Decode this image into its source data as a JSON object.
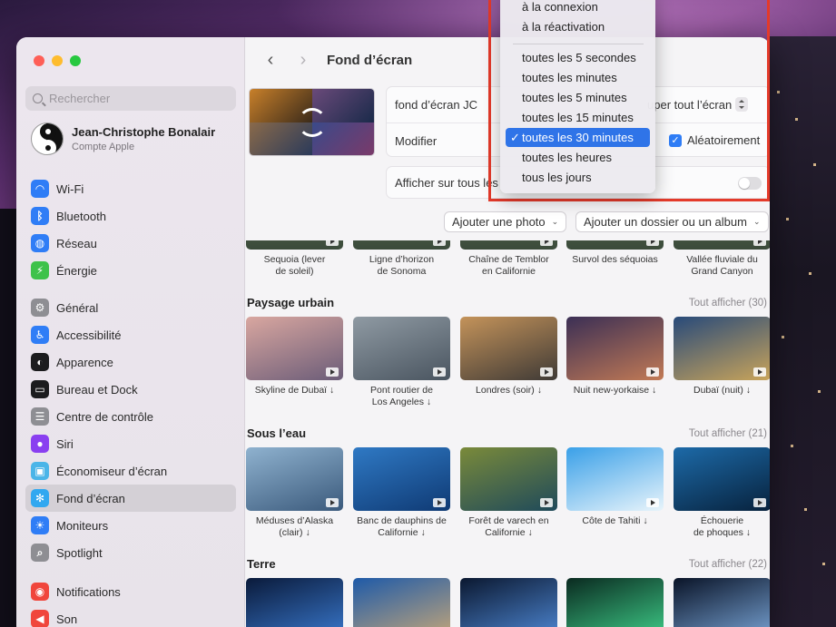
{
  "window": {
    "title": "Fond d’écran"
  },
  "search": {
    "placeholder": "Rechercher"
  },
  "account": {
    "name": "Jean-Christophe Bonalair",
    "subtitle": "Compte Apple"
  },
  "sidebar": {
    "groups": [
      [
        {
          "label": "Wi-Fi",
          "icon": "wifi-icon",
          "color": "#2f7df6"
        },
        {
          "label": "Bluetooth",
          "icon": "bluetooth-icon",
          "color": "#2f7df6"
        },
        {
          "label": "Réseau",
          "icon": "globe-icon",
          "color": "#2f7df6"
        },
        {
          "label": "Énergie",
          "icon": "battery-icon",
          "color": "#3ec24a"
        }
      ],
      [
        {
          "label": "Général",
          "icon": "gear-icon",
          "color": "#8e8e93"
        },
        {
          "label": "Accessibilité",
          "icon": "accessibility-icon",
          "color": "#2f7df6"
        },
        {
          "label": "Apparence",
          "icon": "appearance-icon",
          "color": "#1c1c1e"
        },
        {
          "label": "Bureau et Dock",
          "icon": "dock-icon",
          "color": "#1c1c1e"
        },
        {
          "label": "Centre de contrôle",
          "icon": "control-center-icon",
          "color": "#8e8e93"
        },
        {
          "label": "Siri",
          "icon": "siri-icon",
          "color": "#8a3ff0"
        },
        {
          "label": "Économiseur d’écran",
          "icon": "screensaver-icon",
          "color": "#4bb5e8"
        },
        {
          "label": "Fond d’écran",
          "icon": "wallpaper-icon",
          "color": "#31a8f0",
          "active": true
        },
        {
          "label": "Moniteurs",
          "icon": "sun-icon",
          "color": "#2f7df6"
        },
        {
          "label": "Spotlight",
          "icon": "spotlight-icon",
          "color": "#8e8e93"
        }
      ],
      [
        {
          "label": "Notifications",
          "icon": "bell-icon",
          "color": "#f0463c"
        },
        {
          "label": "Son",
          "icon": "speaker-icon",
          "color": "#f0463c"
        }
      ]
    ]
  },
  "settings": {
    "wallpaper_name": "fond d’écran JC",
    "fill_mode_visible": "uper tout l’écran",
    "modify_label": "Modifier",
    "random_label": "Aléatoirement",
    "show_all_spaces_visible": "Afficher sur tous les",
    "show_all_spaces_on": false
  },
  "buttons": {
    "add_photo": "Ajouter une photo",
    "add_folder": "Ajouter un dossier ou un album"
  },
  "menu": {
    "items": [
      "à la connexion",
      "à la réactivation",
      "toutes les 5 secondes",
      "toutes les minutes",
      "toutes les 5 minutes",
      "toutes les 15 minutes",
      "toutes les 30 minutes",
      "toutes les heures",
      "tous les jours"
    ],
    "selected_index": 6,
    "check_glyph": "✓"
  },
  "gallery": {
    "top_row": [
      {
        "caption": "Sequoia (lever\nde soleil)"
      },
      {
        "caption": "Ligne d’horizon\nde Sonoma"
      },
      {
        "caption": "Chaîne de Temblor\nen Californie"
      },
      {
        "caption": "Survol des séquoias"
      },
      {
        "caption": "Vallée fluviale du\nGrand Canyon"
      }
    ],
    "sections": [
      {
        "title": "Paysage urbain",
        "link": "Tout afficher (30)",
        "items": [
          {
            "caption": "Skyline de Dubaï ↓",
            "colors": [
              "#d9a7a0",
              "#6b5c78"
            ]
          },
          {
            "caption": "Pont routier de\nLos Angeles ↓",
            "colors": [
              "#8f9aa3",
              "#4a5560"
            ]
          },
          {
            "caption": "Londres (soir) ↓",
            "colors": [
              "#c4935a",
              "#3f3a36"
            ]
          },
          {
            "caption": "Nuit new-yorkaise ↓",
            "colors": [
              "#3b2f55",
              "#c27a55"
            ]
          },
          {
            "caption": "Dubaï (nuit) ↓",
            "colors": [
              "#284a7a",
              "#c9a45a"
            ]
          }
        ]
      },
      {
        "title": "Sous l’eau",
        "link": "Tout afficher (21)",
        "items": [
          {
            "caption": "Méduses d’Alaska\n(clair) ↓",
            "colors": [
              "#8fb2cf",
              "#3b5a7c"
            ]
          },
          {
            "caption": "Banc de dauphins de\nCalifornie ↓",
            "colors": [
              "#2f79c4",
              "#0f3a74"
            ]
          },
          {
            "caption": "Forêt de varech en\nCalifornie ↓",
            "colors": [
              "#7a8a3a",
              "#1f4a5a"
            ]
          },
          {
            "caption": "Côte de Tahiti ↓",
            "colors": [
              "#3aa0e8",
              "#e8f4fb"
            ]
          },
          {
            "caption": "Échouerie\nde phoques ↓",
            "colors": [
              "#1d6aa8",
              "#07223d"
            ]
          }
        ]
      },
      {
        "title": "Terre",
        "link": "Tout afficher (22)",
        "items": [
          {
            "caption": "",
            "colors": [
              "#0a1a3a",
              "#3a7ad0"
            ]
          },
          {
            "caption": "",
            "colors": [
              "#1e5aa8",
              "#c8a878"
            ]
          },
          {
            "caption": "",
            "colors": [
              "#0b1830",
              "#4f8ad8"
            ]
          },
          {
            "caption": "",
            "colors": [
              "#0a2a20",
              "#3fd08a"
            ]
          },
          {
            "caption": "",
            "colors": [
              "#0a1428",
              "#7aa6d8"
            ]
          }
        ]
      }
    ]
  },
  "colors": {
    "accent": "#2f74e8",
    "highlight_box": "#e43a2a"
  }
}
